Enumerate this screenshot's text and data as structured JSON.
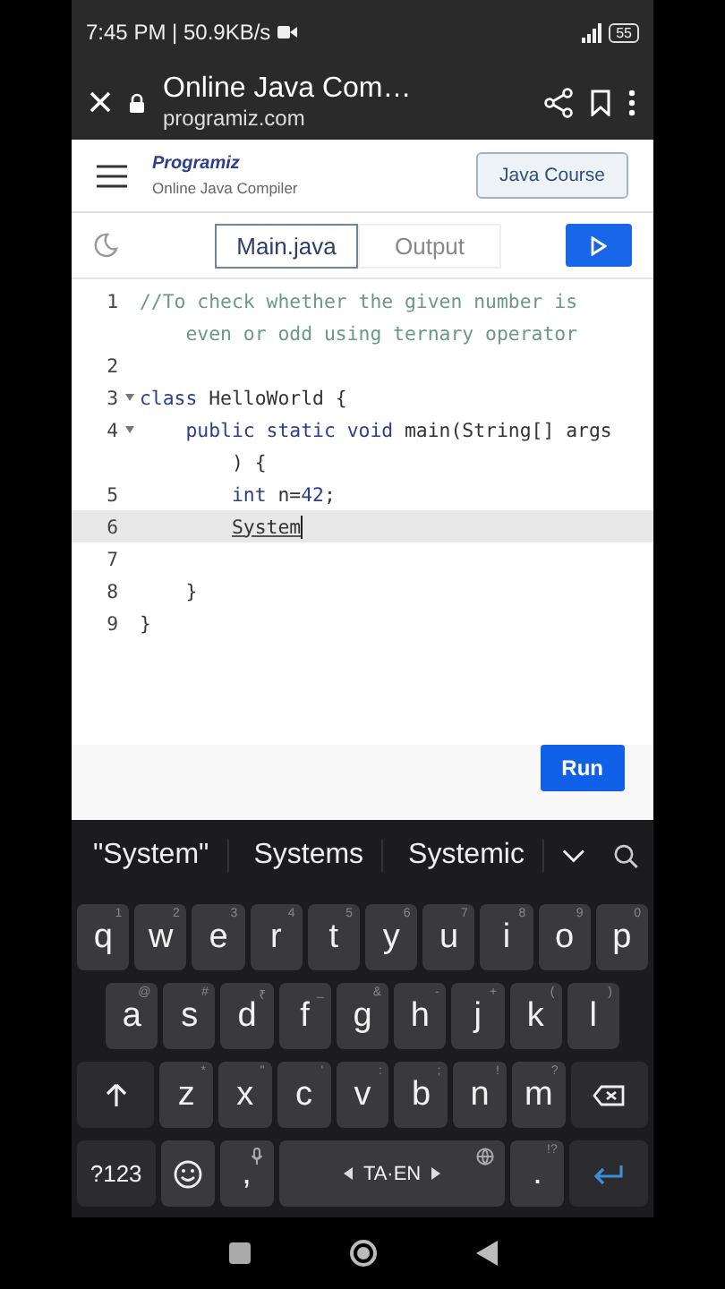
{
  "status_bar": {
    "time": "7:45 PM | 50.9KB/s",
    "battery": "55"
  },
  "browser": {
    "title": "Online Java Com…",
    "url": "programiz.com"
  },
  "site_header": {
    "logo": "Programiz",
    "subtitle": "Online Java Compiler",
    "course_button": "Java Course"
  },
  "editor_tabs": [
    {
      "label": "Main.java",
      "selected": true
    },
    {
      "label": "Output",
      "selected": false
    }
  ],
  "code_lines": [
    {
      "number": "1",
      "foldable": false,
      "selected": false,
      "tokens": [
        {
          "text": "//To check whether the given number is",
          "kind": "comment"
        }
      ],
      "wrap": [
        {
          "text": "    even or odd using ternary operator",
          "kind": "comment"
        }
      ]
    },
    {
      "number": "2",
      "foldable": false,
      "selected": false
    },
    {
      "number": "3",
      "foldable": true,
      "selected": false,
      "tokens": [
        {
          "text": "class ",
          "kind": "keyword"
        },
        {
          "text": "HelloWorld {",
          "kind": "plain"
        }
      ]
    },
    {
      "number": "4",
      "foldable": true,
      "selected": false,
      "tokens": [
        {
          "text": "    public static void ",
          "kind": "keyword"
        },
        {
          "text": "main(String[] args",
          "kind": "plain"
        }
      ],
      "wrap": [
        {
          "text": "        ) {",
          "kind": "plain"
        }
      ]
    },
    {
      "number": "5",
      "foldable": false,
      "selected": false,
      "tokens": [
        {
          "text": "        int ",
          "kind": "keyword"
        },
        {
          "text": "n=",
          "kind": "plain"
        },
        {
          "text": "42",
          "kind": "number"
        },
        {
          "text": ";",
          "kind": "plain"
        }
      ]
    },
    {
      "number": "6",
      "foldable": false,
      "selected": true,
      "tokens": [
        {
          "text": "System",
          "kind": "composing"
        }
      ]
    },
    {
      "number": "7",
      "foldable": false,
      "selected": false
    },
    {
      "number": "8",
      "foldable": false,
      "selected": false,
      "tokens": [
        {
          "text": "    }",
          "kind": "plain"
        }
      ]
    },
    {
      "number": "9",
      "foldable": false,
      "selected": false,
      "tokens": [
        {
          "text": "}",
          "kind": "plain"
        }
      ]
    }
  ],
  "run_button": "Run",
  "suggestions": [
    "\"System\"",
    "Systems",
    "Systemic"
  ],
  "keyboard": [
    [
      {
        "kind": "letter",
        "label": "q",
        "hint": "1"
      },
      {
        "kind": "letter",
        "label": "w",
        "hint": "2"
      },
      {
        "kind": "letter",
        "label": "e",
        "hint": "3"
      },
      {
        "kind": "letter",
        "label": "r",
        "hint": "4"
      },
      {
        "kind": "letter",
        "label": "t",
        "hint": "5"
      },
      {
        "kind": "letter",
        "label": "y",
        "hint": "6"
      },
      {
        "kind": "letter",
        "label": "u",
        "hint": "7"
      },
      {
        "kind": "letter",
        "label": "i",
        "hint": "8"
      },
      {
        "kind": "letter",
        "label": "o",
        "hint": "9"
      },
      {
        "kind": "letter",
        "label": "p",
        "hint": "0"
      }
    ],
    [
      {
        "kind": "letter",
        "label": "a",
        "hint": "@"
      },
      {
        "kind": "letter",
        "label": "s",
        "hint": "#"
      },
      {
        "kind": "letter",
        "label": "d",
        "hint": "₹"
      },
      {
        "kind": "letter",
        "label": "f",
        "hint": "_"
      },
      {
        "kind": "letter",
        "label": "g",
        "hint": "&"
      },
      {
        "kind": "letter",
        "label": "h",
        "hint": "-"
      },
      {
        "kind": "letter",
        "label": "j",
        "hint": "+"
      },
      {
        "kind": "letter",
        "label": "k",
        "hint": "("
      },
      {
        "kind": "letter",
        "label": "l",
        "hint": ")"
      }
    ],
    [
      {
        "kind": "shift"
      },
      {
        "kind": "letter",
        "label": "z",
        "hint": "*"
      },
      {
        "kind": "letter",
        "label": "x",
        "hint": "\""
      },
      {
        "kind": "letter",
        "label": "c",
        "hint": "'"
      },
      {
        "kind": "letter",
        "label": "v",
        "hint": ":"
      },
      {
        "kind": "letter",
        "label": "b",
        "hint": ";"
      },
      {
        "kind": "letter",
        "label": "n",
        "hint": "!"
      },
      {
        "kind": "letter",
        "label": "m",
        "hint": "?"
      },
      {
        "kind": "backspace"
      }
    ],
    [
      {
        "kind": "symbols",
        "label": "?123"
      },
      {
        "kind": "emoji"
      },
      {
        "kind": "comma",
        "label": ","
      },
      {
        "kind": "space",
        "label": "TA·EN"
      },
      {
        "kind": "period",
        "label": ".",
        "hint": "!?"
      },
      {
        "kind": "enter"
      }
    ]
  ]
}
